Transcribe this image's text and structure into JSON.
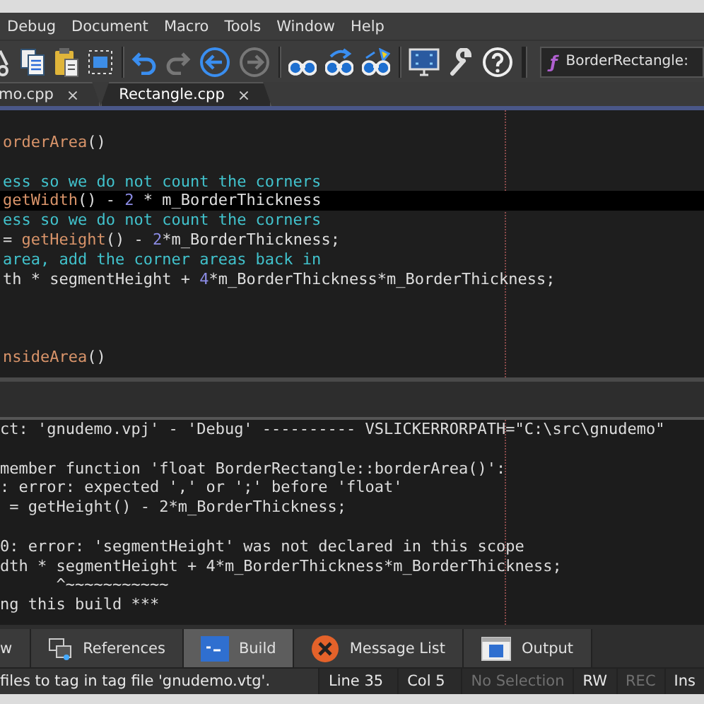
{
  "menu": [
    "Debug",
    "Document",
    "Macro",
    "Tools",
    "Window",
    "Help"
  ],
  "toolbar": {
    "buttons": [
      {
        "kind": "cut"
      },
      {
        "kind": "copy"
      },
      {
        "kind": "paste"
      },
      {
        "kind": "select",
        "sep_after": true
      },
      {
        "kind": "undo"
      },
      {
        "kind": "redo"
      },
      {
        "kind": "back"
      },
      {
        "kind": "forward",
        "sep_after": true
      },
      {
        "kind": "find"
      },
      {
        "kind": "replace"
      },
      {
        "kind": "findfiles",
        "sep_after": true
      },
      {
        "kind": "screen"
      },
      {
        "kind": "wrench"
      },
      {
        "kind": "help"
      }
    ],
    "symbol_combo": {
      "icon": "ƒ",
      "value": "BorderRectangle:"
    }
  },
  "file_tabs": [
    {
      "label": "mo.cpp",
      "close": "×",
      "selected": false
    },
    {
      "label": "Rectangle.cpp",
      "close": "×",
      "selected": true
    }
  ],
  "editor": {
    "lines": [
      {
        "segments": [
          {
            "kind": "func",
            "text": "orderArea"
          },
          {
            "kind": "plain",
            "text": "()"
          }
        ]
      },
      {
        "space_before": true,
        "segments": [
          {
            "kind": "comment",
            "text": "ess so we do not count the corners"
          }
        ]
      },
      {
        "current": true,
        "segments": [
          {
            "kind": "func",
            "text": "getWidth"
          },
          {
            "kind": "plain",
            "text": "() - "
          },
          {
            "kind": "number",
            "text": "2"
          },
          {
            "kind": "plain",
            "text": " * m_BorderThickness"
          }
        ]
      },
      {
        "segments": [
          {
            "kind": "comment",
            "text": "ess so we do not count the corners"
          }
        ]
      },
      {
        "segments": [
          {
            "kind": "plain",
            "text": "= "
          },
          {
            "kind": "func",
            "text": "getHeight"
          },
          {
            "kind": "plain",
            "text": "() - "
          },
          {
            "kind": "number",
            "text": "2"
          },
          {
            "kind": "plain",
            "text": "*m_BorderThickness;"
          }
        ]
      },
      {
        "segments": [
          {
            "kind": "comment",
            "text": "area, add the corner areas back in"
          }
        ]
      },
      {
        "segments": [
          {
            "kind": "plain",
            "text": "th * segmentHeight + "
          },
          {
            "kind": "number",
            "text": "4"
          },
          {
            "kind": "plain",
            "text": "*m_BorderThickness*m_BorderThickness;"
          }
        ]
      },
      {
        "bottom": true,
        "segments": [
          {
            "kind": "func",
            "text": "nsideArea"
          },
          {
            "kind": "plain",
            "text": "()"
          }
        ]
      }
    ]
  },
  "output": {
    "lines": [
      {
        "text": "ct: 'gnudemo.vpj' - 'Debug' ---------- VSLICKERRORPATH=\"C:\\src\\gnudemo\""
      },
      {
        "space_before": true,
        "text": "member function 'float BorderRectangle::borderArea()':"
      },
      {
        "text": ": error: expected ',' or ';' before 'float'"
      },
      {
        "text": " = getHeight() - 2*m_BorderThickness;"
      },
      {
        "space_before": true,
        "text": "0: error: 'segmentHeight' was not declared in this scope"
      },
      {
        "text": "dth * segmentHeight + 4*m_BorderThickness*m_BorderThickness;"
      },
      {
        "text": "      ^~~~~~~~~~~~"
      },
      {
        "text": "ng this build ***"
      }
    ]
  },
  "panel_tabs": [
    {
      "label": "w",
      "selected": false
    },
    {
      "label": "References",
      "kind": "references",
      "selected": false
    },
    {
      "label": "Build",
      "kind": "build",
      "selected": true
    },
    {
      "label": "Message List",
      "kind": "messages",
      "selected": false
    },
    {
      "label": "Output",
      "kind": "output",
      "selected": false
    }
  ],
  "status_bar": [
    {
      "text": "files to tag in tag file 'gnudemo.vtg'.",
      "kind": "message",
      "disabled": false
    },
    {
      "text": "Line 35",
      "kind": "cell",
      "disabled": false
    },
    {
      "text": "Col 5",
      "kind": "cell",
      "disabled": false
    },
    {
      "text": "No Selection",
      "kind": "cell",
      "disabled": true
    },
    {
      "text": "RW",
      "kind": "cell",
      "disabled": false
    },
    {
      "text": "REC",
      "kind": "cell",
      "disabled": true
    },
    {
      "text": "Ins",
      "kind": "cell",
      "disabled": false
    }
  ]
}
